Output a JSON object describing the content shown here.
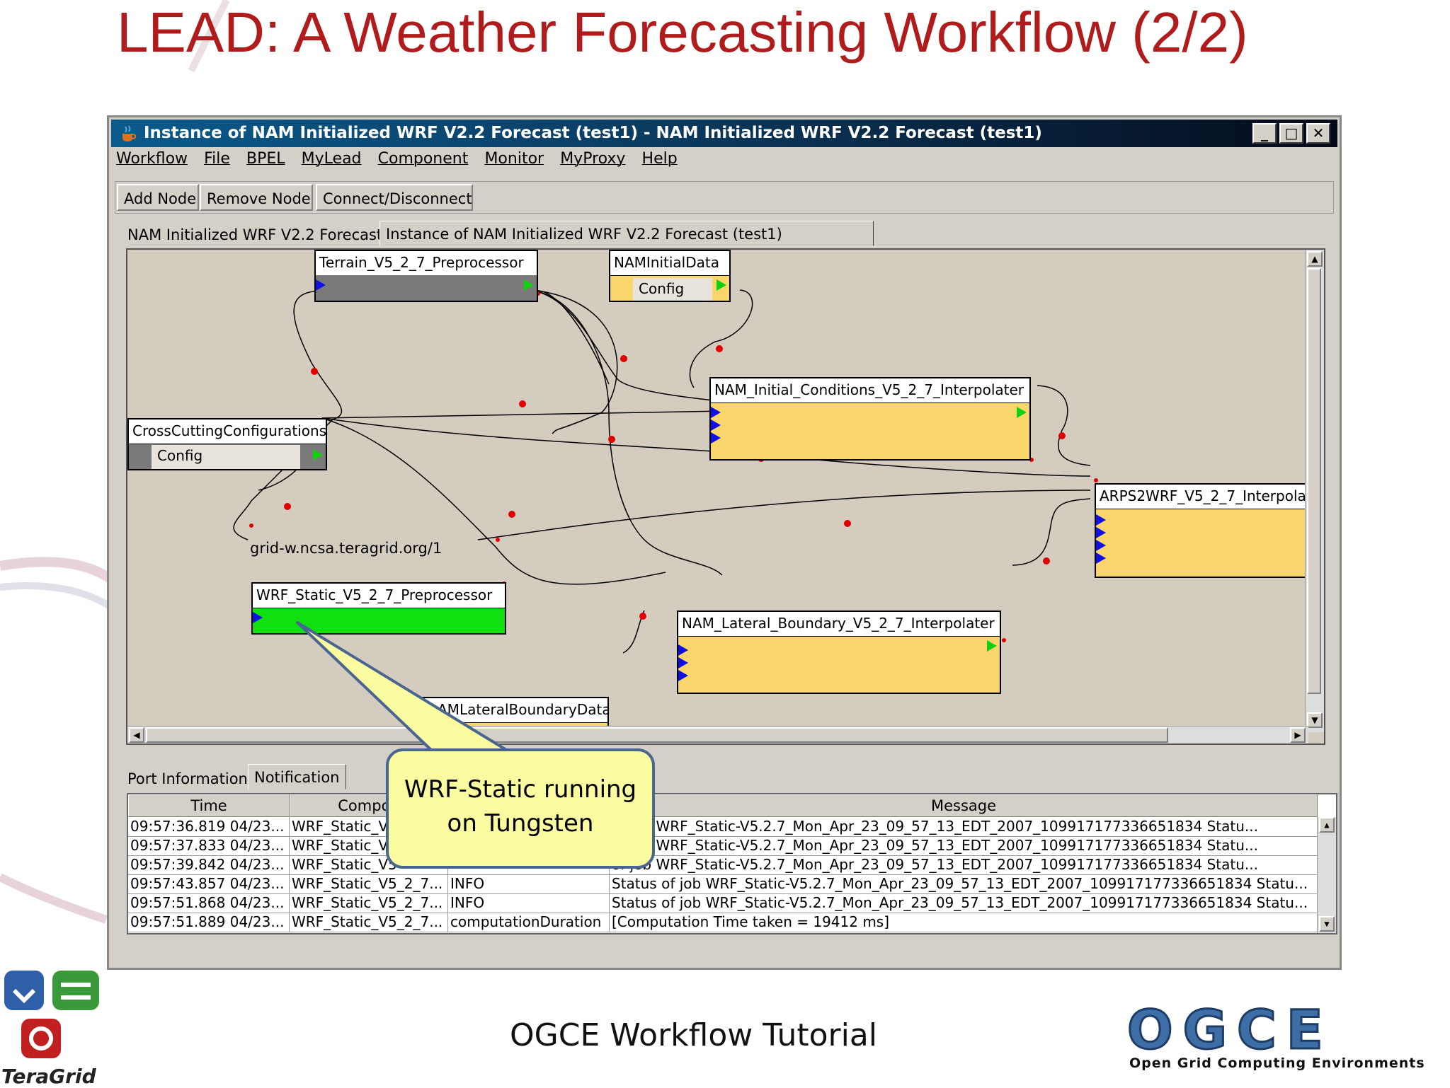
{
  "slide": {
    "title": "LEAD: A Weather Forecasting Workflow (2/2)",
    "footer": "OGCE Workflow Tutorial",
    "ogce_logo_text": "OGCE",
    "ogce_tagline": "Open Grid Computing Environments",
    "teragrid_logo_text": "TeraGrid"
  },
  "window": {
    "title": "Instance of NAM Initialized WRF V2.2 Forecast (test1) - NAM Initialized WRF V2.2 Forecast (test1)",
    "buttons": {
      "minimize": "_",
      "maximize": "□",
      "close": "✕"
    }
  },
  "menu": [
    "Workflow",
    "File",
    "BPEL",
    "MyLead",
    "Component",
    "Monitor",
    "MyProxy",
    "Help"
  ],
  "toolbar": {
    "add_node": "Add Node",
    "remove_node": "Remove Node",
    "connect": "Connect/Disconnect"
  },
  "tabs": [
    "NAM Initialized WRF V2.2 Forecast",
    "Instance of NAM Initialized WRF V2.2 Forecast (test1)"
  ],
  "nodes": {
    "terrain": "Terrain_V5_2_7_Preprocessor",
    "naminit": "NAMInitialData",
    "naminit_config": "Config",
    "nam_ic": "NAM_Initial_Conditions_V5_2_7_Interpolater",
    "crosscut": "CrossCuttingConfigurations",
    "crosscut_config": "Config",
    "arps2wrf": "ARPS2WRF_V5_2_7_Interpolat",
    "wrfstatic": "WRF_Static_V5_2_7_Preprocessor",
    "wrfstatic_host": "grid-w.ncsa.teragrid.org/1",
    "nam_lb": "NAM_Lateral_Boundary_V5_2_7_Interpolater",
    "namlb_data": "AMLateralBoundaryData"
  },
  "bottom_tabs": [
    "Port Information",
    "Notification"
  ],
  "table": {
    "headers": [
      "Time",
      "Compon",
      "",
      "Message"
    ],
    "rows": [
      [
        "09:57:36.819 04/23...",
        "WRF_Static_V",
        "",
        " of job WRF_Static-V5.2.7_Mon_Apr_23_09_57_13_EDT_2007_109917177336651834 Statu..."
      ],
      [
        "09:57:37.833 04/23...",
        "WRF_Static_V",
        "",
        " of job WRF_Static-V5.2.7_Mon_Apr_23_09_57_13_EDT_2007_109917177336651834 Statu..."
      ],
      [
        "09:57:39.842 04/23...",
        "WRF_Static_V5",
        "",
        " of job WRF_Static-V5.2.7_Mon_Apr_23_09_57_13_EDT_2007_109917177336651834 Statu..."
      ],
      [
        "09:57:43.857 04/23...",
        "WRF_Static_V5_2_7...",
        "INFO",
        "Status of job WRF_Static-V5.2.7_Mon_Apr_23_09_57_13_EDT_2007_109917177336651834 Statu..."
      ],
      [
        "09:57:51.868 04/23...",
        "WRF_Static_V5_2_7...",
        "INFO",
        "Status of job WRF_Static-V5.2.7_Mon_Apr_23_09_57_13_EDT_2007_109917177336651834 Statu..."
      ],
      [
        "09:57:51.889 04/23...",
        "WRF_Static_V5_2_7...",
        "computationDuration",
        "[Computation Time taken = 19412 ms]"
      ]
    ]
  },
  "callout": {
    "line1": "WRF-Static running",
    "line2": "on Tungsten"
  },
  "colors": {
    "title_red": "#b01c1c",
    "node_yellow": "#f9d66b",
    "node_gray": "#7a7a7a",
    "node_running": "#10e010",
    "callout_fill": "#fafaa0"
  }
}
